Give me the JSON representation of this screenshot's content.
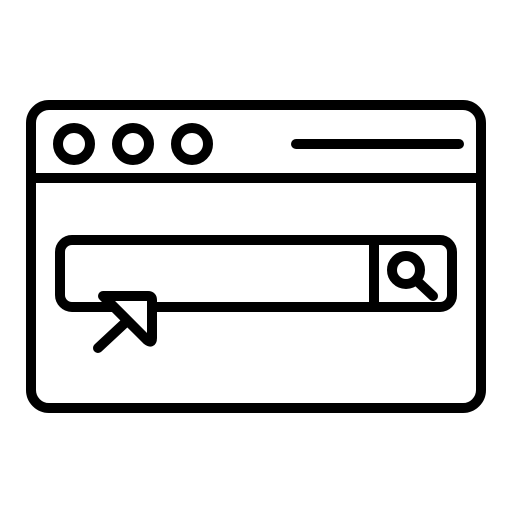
{
  "icon": {
    "name": "browser-search-icon",
    "stroke_color": "#000000",
    "background_color": "#ffffff",
    "window_control_count": 3
  }
}
